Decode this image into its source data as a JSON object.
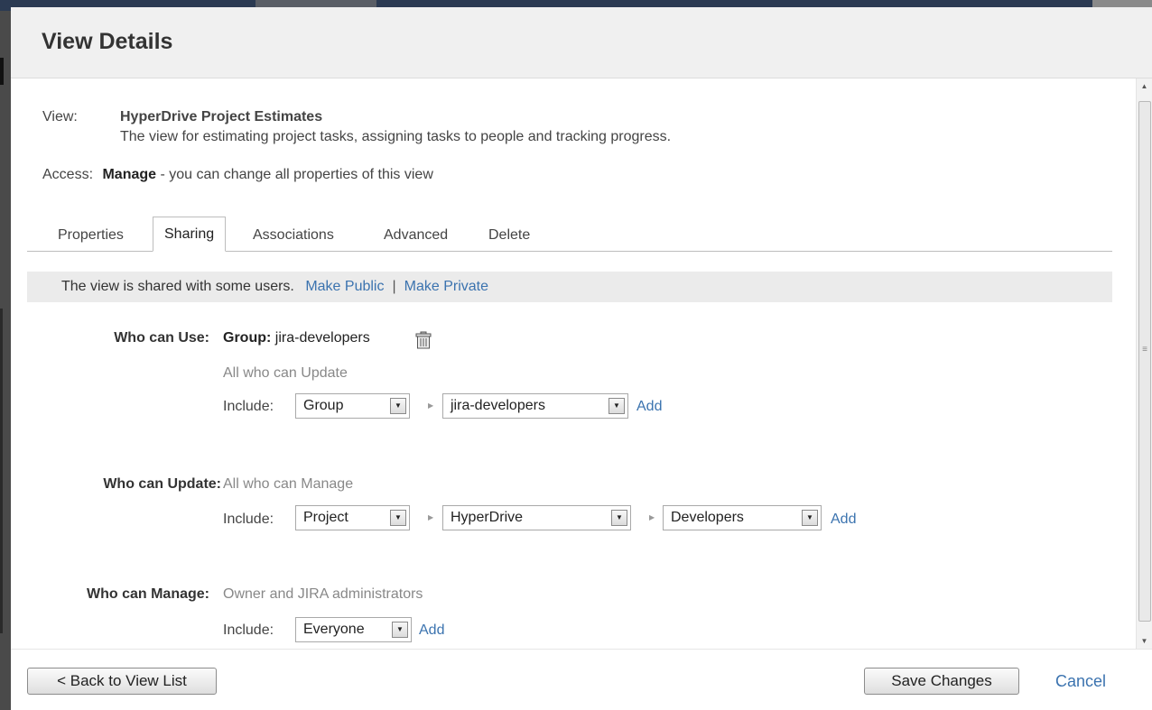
{
  "dialog": {
    "title": "View Details"
  },
  "view_info": {
    "view_label": "View:",
    "view_name": "HyperDrive Project Estimates",
    "view_description": "The view for estimating project tasks, assigning tasks to people and tracking progress.",
    "access_label": "Access:",
    "access_level": "Manage",
    "access_description": " - you can change all properties of this view"
  },
  "tabs": [
    {
      "label": "Properties",
      "active": false
    },
    {
      "label": "Sharing",
      "active": true
    },
    {
      "label": "Associations",
      "active": false
    },
    {
      "label": "Advanced",
      "active": false
    },
    {
      "label": "Delete",
      "active": false
    }
  ],
  "share_bar": {
    "status": "The view is shared with some users.",
    "make_public": "Make Public",
    "separator": "|",
    "make_private": "Make Private"
  },
  "who_can_use": {
    "label": "Who can Use:",
    "group_prefix": "Group:",
    "group_name": "jira-developers",
    "inherited": "All who can Update",
    "include_label": "Include:",
    "type_select": "Group",
    "value_select": "jira-developers",
    "add_link": "Add"
  },
  "who_can_update": {
    "label": "Who can Update:",
    "inherited": "All who can Manage",
    "include_label": "Include:",
    "type_select": "Project",
    "project_select": "HyperDrive",
    "role_select": "Developers",
    "add_link": "Add"
  },
  "who_can_manage": {
    "label": "Who can Manage:",
    "inherited": "Owner and JIRA administrators",
    "include_label": "Include:",
    "type_select": "Everyone",
    "add_link": "Add"
  },
  "footer": {
    "back_button": "< Back to View List",
    "save_button": "Save Changes",
    "cancel_link": "Cancel"
  },
  "icons": {
    "trash": "trash-icon",
    "dropdown": "chevron-down-icon",
    "arrow_right": "triangle-right-icon",
    "scroll_up": "arrow-up-icon",
    "scroll_down": "arrow-down-icon"
  },
  "colors": {
    "link": "#3b73af",
    "header_bg": "#f0f0f0",
    "share_bar_bg": "#ebebeb",
    "muted_text": "#888888"
  }
}
